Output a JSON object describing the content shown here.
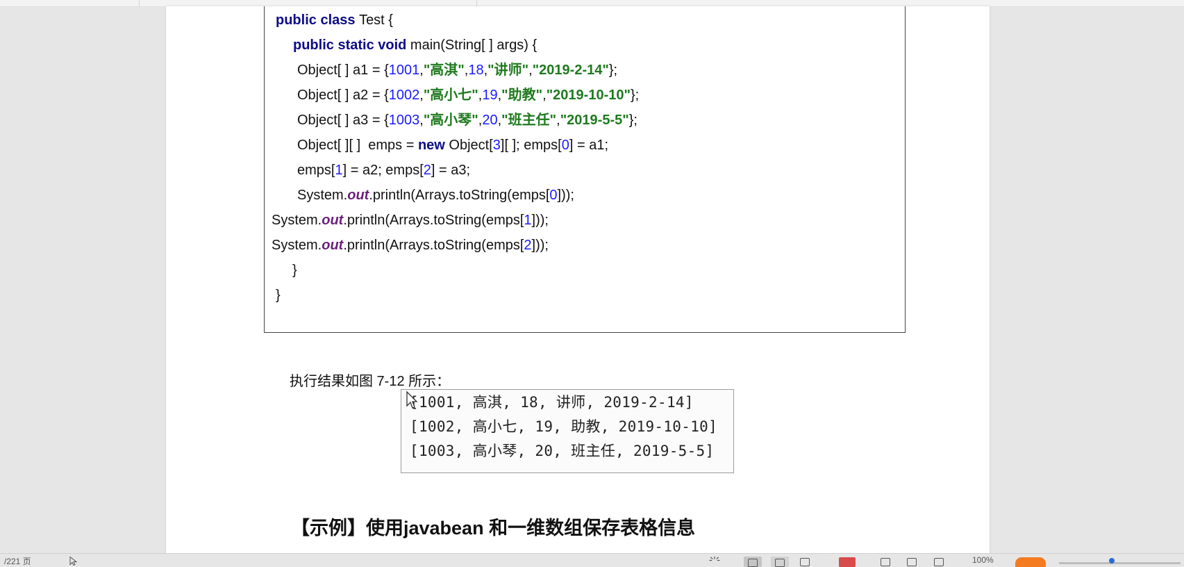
{
  "code": {
    "lines": [
      [
        {
          "t": "public class ",
          "c": "kw"
        },
        {
          "t": "Test {",
          "c": ""
        }
      ],
      [
        {
          "t": "public static void ",
          "c": "kw"
        },
        {
          "t": "main(String[ ] args) {",
          "c": ""
        }
      ],
      [
        {
          "t": "Object[ ] a1 = {",
          "c": ""
        },
        {
          "t": "1001",
          "c": "num"
        },
        {
          "t": ",",
          "c": ""
        },
        {
          "t": "\"高淇\"",
          "c": "str"
        },
        {
          "t": ",",
          "c": ""
        },
        {
          "t": "18",
          "c": "num"
        },
        {
          "t": ",",
          "c": ""
        },
        {
          "t": "\"讲师\"",
          "c": "str"
        },
        {
          "t": ",",
          "c": ""
        },
        {
          "t": "\"2019-2-14\"",
          "c": "str"
        },
        {
          "t": "};",
          "c": ""
        }
      ],
      [
        {
          "t": "Object[ ] a2 = {",
          "c": ""
        },
        {
          "t": "1002",
          "c": "num"
        },
        {
          "t": ",",
          "c": ""
        },
        {
          "t": "\"高小七\"",
          "c": "str"
        },
        {
          "t": ",",
          "c": ""
        },
        {
          "t": "19",
          "c": "num"
        },
        {
          "t": ",",
          "c": ""
        },
        {
          "t": "\"助教\"",
          "c": "str"
        },
        {
          "t": ",",
          "c": ""
        },
        {
          "t": "\"2019-10-10\"",
          "c": "str"
        },
        {
          "t": "};",
          "c": ""
        }
      ],
      [
        {
          "t": "Object[ ] a3 = {",
          "c": ""
        },
        {
          "t": "1003",
          "c": "num"
        },
        {
          "t": ",",
          "c": ""
        },
        {
          "t": "\"高小琴\"",
          "c": "str"
        },
        {
          "t": ",",
          "c": ""
        },
        {
          "t": "20",
          "c": "num"
        },
        {
          "t": ",",
          "c": ""
        },
        {
          "t": "\"班主任\"",
          "c": "str"
        },
        {
          "t": ",",
          "c": ""
        },
        {
          "t": "\"2019-5-5\"",
          "c": "str"
        },
        {
          "t": "};",
          "c": ""
        }
      ],
      [
        {
          "t": "Object[ ][ ]  emps = ",
          "c": ""
        },
        {
          "t": "new ",
          "c": "kw"
        },
        {
          "t": "Object[",
          "c": ""
        },
        {
          "t": "3",
          "c": "num"
        },
        {
          "t": "][ ]; emps[",
          "c": ""
        },
        {
          "t": "0",
          "c": "num"
        },
        {
          "t": "] = a1;",
          "c": ""
        }
      ],
      [
        {
          "t": "emps[",
          "c": ""
        },
        {
          "t": "1",
          "c": "num"
        },
        {
          "t": "] = a2; emps[",
          "c": ""
        },
        {
          "t": "2",
          "c": "num"
        },
        {
          "t": "] = a3;",
          "c": ""
        }
      ],
      [
        {
          "t": "System.",
          "c": ""
        },
        {
          "t": "out",
          "c": "out"
        },
        {
          "t": ".println(Arrays.toString(emps[",
          "c": ""
        },
        {
          "t": "0",
          "c": "num"
        },
        {
          "t": "]));",
          "c": ""
        }
      ],
      [
        {
          "t": "System.",
          "c": ""
        },
        {
          "t": "out",
          "c": "out"
        },
        {
          "t": ".println(Arrays.toString(emps[",
          "c": ""
        },
        {
          "t": "1",
          "c": "num"
        },
        {
          "t": "]));",
          "c": ""
        }
      ],
      [
        {
          "t": "System.",
          "c": ""
        },
        {
          "t": "out",
          "c": "out"
        },
        {
          "t": ".println(Arrays.toString(emps[",
          "c": ""
        },
        {
          "t": "2",
          "c": "num"
        },
        {
          "t": "]));",
          "c": ""
        }
      ],
      [
        {
          "t": "}",
          "c": ""
        }
      ],
      [
        {
          "t": "}",
          "c": ""
        }
      ]
    ]
  },
  "caption": "执行结果如图 7-12 所示：",
  "result_lines": [
    "[1001, 高淇, 18, 讲师, 2019-2-14]",
    "[1002, 高小七, 19, 助教, 2019-10-10]",
    "[1003, 高小琴, 20, 班主任, 2019-5-5]"
  ],
  "example_heading": "【示例】使用javabean 和一维数组保存表格信息",
  "status_bar": {
    "page_info": "/221 页",
    "zoom": "100%"
  },
  "colors": {
    "keyword": "#0c0c86",
    "number": "#1a1aff",
    "string": "#1f7a1f",
    "static_field": "#6a1f7a"
  }
}
